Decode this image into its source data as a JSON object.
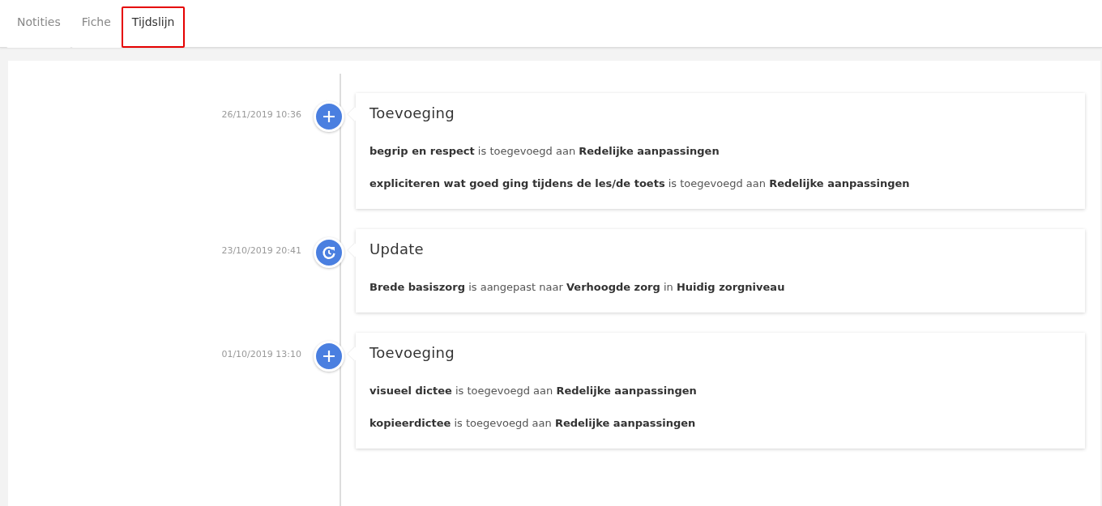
{
  "tabs": [
    {
      "label": "Notities",
      "selected": false
    },
    {
      "label": "Fiche",
      "selected": false
    },
    {
      "label": "Tijdslijn",
      "selected": true
    }
  ],
  "timeline": [
    {
      "date": "26/11/2019 10:36",
      "kind": "add",
      "title": "Toevoeging",
      "lines": [
        "**begrip en respect** is toegevoegd aan **Redelijke aanpassingen**",
        "**expliciteren wat goed ging tijdens de les/de toets** is toegevoegd aan **Redelijke aanpassingen**"
      ]
    },
    {
      "date": "23/10/2019 20:41",
      "kind": "update",
      "title": "Update",
      "lines": [
        "**Brede basiszorg** is aangepast naar **Verhoogde zorg** in **Huidig zorgniveau**"
      ]
    },
    {
      "date": "01/10/2019 13:10",
      "kind": "add",
      "title": "Toevoeging",
      "lines": [
        "**visueel dictee** is toegevoegd aan **Redelijke aanpassingen**",
        "**kopieerdictee** is toegevoegd aan **Redelijke aanpassingen**"
      ]
    }
  ]
}
